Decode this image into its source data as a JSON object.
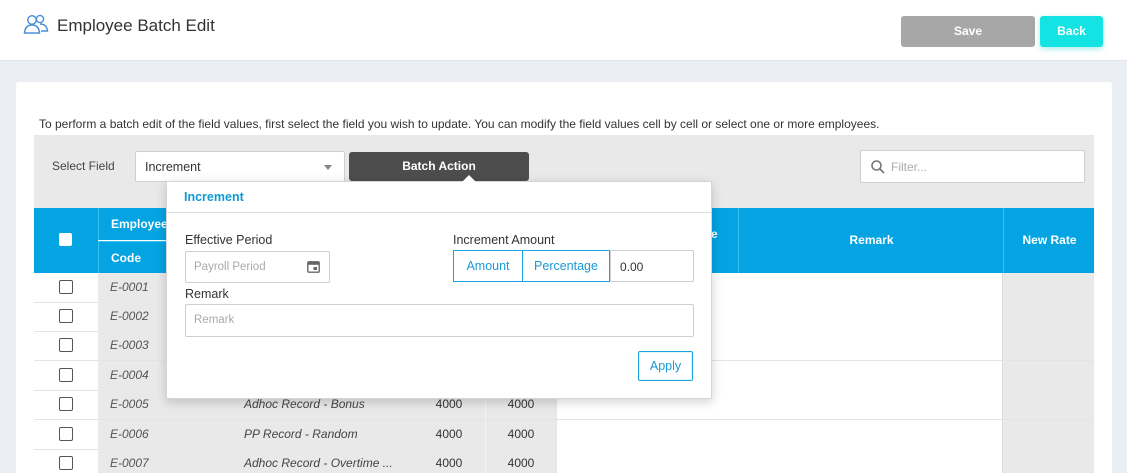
{
  "header": {
    "title": "Employee Batch Edit",
    "save_label": "Save",
    "back_label": "Back"
  },
  "instructions": "To perform a batch edit of the field values, first select the field you wish to update. You can modify the field values cell by cell or select one or more employees.",
  "toolbar": {
    "select_field_label": "Select Field",
    "select_field_value": "Increment",
    "batch_action_label": "Batch Action",
    "filter_placeholder": "Filter..."
  },
  "table": {
    "headers": {
      "employee": "Employee",
      "code": "Code",
      "hidden_partial": "e",
      "remark": "Remark",
      "new_rate": "New Rate"
    },
    "rows": [
      {
        "code": "E-0001",
        "name": "",
        "v1": "",
        "v2": ""
      },
      {
        "code": "E-0002",
        "name": "",
        "v1": "",
        "v2": ""
      },
      {
        "code": "E-0003",
        "name": "",
        "v1": "",
        "v2": ""
      },
      {
        "code": "E-0004",
        "name": "",
        "v1": "",
        "v2": ""
      },
      {
        "code": "E-0005",
        "name": "Adhoc Record - Bonus",
        "v1": "4000",
        "v2": "4000"
      },
      {
        "code": "E-0006",
        "name": "PP Record - Random",
        "v1": "4000",
        "v2": "4000"
      },
      {
        "code": "E-0007",
        "name": "Adhoc Record - Overtime ...",
        "v1": "4000",
        "v2": "4000"
      }
    ]
  },
  "popover": {
    "title": "Increment",
    "effective_period_label": "Effective Period",
    "payroll_period_placeholder": "Payroll Period",
    "increment_amount_label": "Increment Amount",
    "amount_label": "Amount",
    "percentage_label": "Percentage",
    "amount_value": "0.00",
    "remark_label": "Remark",
    "remark_placeholder": "Remark",
    "apply_label": "Apply"
  },
  "colors": {
    "header_blue": "#04a4e3",
    "accent_cyan": "#13e3e3",
    "batch_dark": "#4d4d4d",
    "save_gray": "#a7a7a7"
  }
}
